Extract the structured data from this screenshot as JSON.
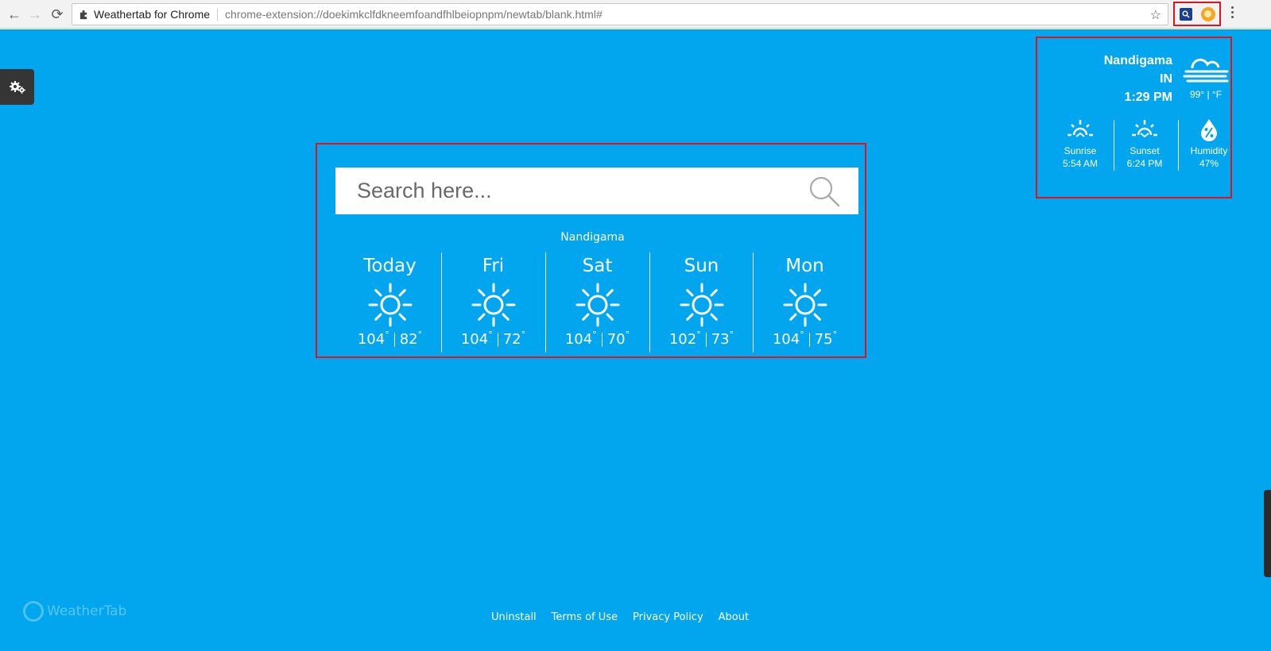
{
  "browser": {
    "tab_title": "Weathertab for Chrome",
    "url": "chrome-extension://doekimkclfdkneemfoandfhlbeiopnpm/newtab/blank.html#"
  },
  "current": {
    "city": "Nandigama",
    "country": "IN",
    "time": "1:29 PM",
    "temp": "99° | °F",
    "sunrise_label": "Sunrise",
    "sunrise_time": "5:54 AM",
    "sunset_label": "Sunset",
    "sunset_time": "6:24 PM",
    "humidity_label": "Humidity",
    "humidity_value": "47%"
  },
  "search": {
    "placeholder": "Search here..."
  },
  "forecast": {
    "city": "Nandigama",
    "days": [
      {
        "name": "Today",
        "high": "104",
        "low": "82"
      },
      {
        "name": "Fri",
        "high": "104",
        "low": "72"
      },
      {
        "name": "Sat",
        "high": "104",
        "low": "70"
      },
      {
        "name": "Sun",
        "high": "102",
        "low": "73"
      },
      {
        "name": "Mon",
        "high": "104",
        "low": "75"
      }
    ]
  },
  "logo": "WeatherTab",
  "footer": {
    "uninstall": "Uninstall",
    "terms": "Terms of Use",
    "privacy": "Privacy Policy",
    "about": "About"
  },
  "colors": {
    "page_bg": "#01a6ee",
    "highlight": "#e0141e"
  }
}
